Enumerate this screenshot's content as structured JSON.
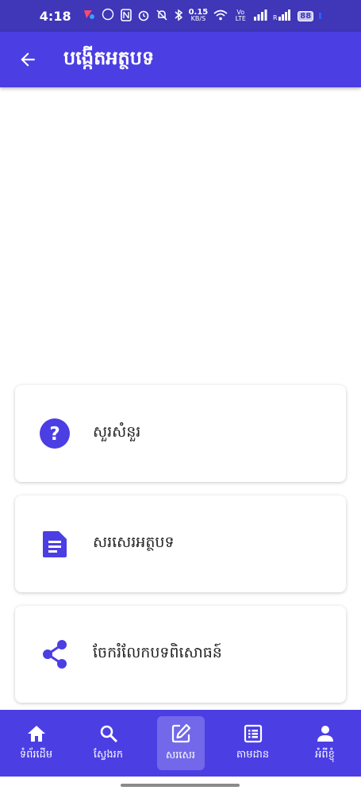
{
  "status_bar": {
    "time": "4:18",
    "network_speed_value": "0.15",
    "network_speed_unit": "KB/S",
    "volte": "Vo LTE",
    "battery": "88"
  },
  "header": {
    "title": "បង្កើតអត្ថបទ"
  },
  "actions": [
    {
      "label": "សួរសំនួរ",
      "icon": "question-icon"
    },
    {
      "label": "សរសេរអត្ថបទ",
      "icon": "document-icon"
    },
    {
      "label": "ចែករំលែកបទពិសោធន៍",
      "icon": "share-icon"
    }
  ],
  "bottom_nav": {
    "items": [
      {
        "label": "ទំព័រដើម",
        "icon": "home-icon"
      },
      {
        "label": "ស្វែងរក",
        "icon": "search-icon"
      },
      {
        "label": "សរសេរ",
        "icon": "edit-icon",
        "active": true
      },
      {
        "label": "តាមដាន",
        "icon": "list-icon"
      },
      {
        "label": "អំពីខ្ញុំ",
        "icon": "person-icon"
      }
    ]
  },
  "colors": {
    "primary": "#4b3ee3",
    "status_bar": "#3f36b8",
    "icon": "#4b3ee3"
  }
}
